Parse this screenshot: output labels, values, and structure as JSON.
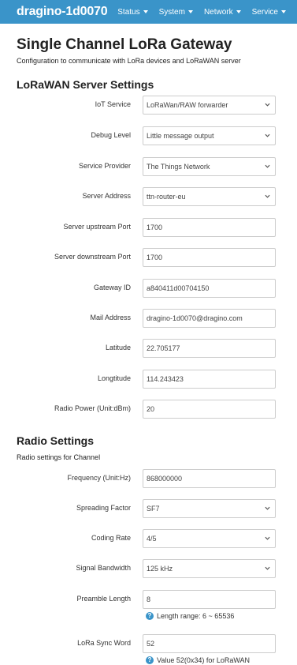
{
  "navbar": {
    "brand": "dragino-1d0070",
    "menu": [
      "Status",
      "System",
      "Network",
      "Service"
    ]
  },
  "page": {
    "title": "Single Channel LoRa Gateway",
    "description": "Configuration to communicate with LoRa devices and LoRaWAN server"
  },
  "lorawan": {
    "title": "LoRaWAN Server Settings",
    "fields": [
      {
        "label": "IoT Service",
        "value": "LoRaWan/RAW forwarder"
      },
      {
        "label": "Debug Level",
        "value": "Little message output"
      },
      {
        "label": "Service Provider",
        "value": "The Things Network"
      },
      {
        "label": "Server Address",
        "value": "ttn-router-eu"
      },
      {
        "label": "Server upstream Port",
        "value": "1700"
      },
      {
        "label": "Server downstream Port",
        "value": "1700"
      },
      {
        "label": "Gateway ID",
        "value": "a840411d00704150"
      },
      {
        "label": "Mail Address",
        "value": "dragino-1d0070@dragino.com"
      },
      {
        "label": "Latitude",
        "value": "22.705177"
      },
      {
        "label": "Longtitude",
        "value": "114.243423"
      },
      {
        "label": "Radio Power (Unit:dBm)",
        "value": "20"
      }
    ]
  },
  "radio": {
    "title": "Radio Settings",
    "description": "Radio settings for Channel",
    "fields": [
      {
        "label": "Frequency (Unit:Hz)",
        "value": "868000000"
      },
      {
        "label": "Spreading Factor",
        "value": "SF7"
      },
      {
        "label": "Coding Rate",
        "value": "4/5"
      },
      {
        "label": "Signal Bandwidth",
        "value": "125 kHz"
      },
      {
        "label": "Preamble Length",
        "value": "8",
        "help": "Length range: 6 ~ 65536"
      },
      {
        "label": "LoRa Sync Word",
        "value": "52",
        "help": "Value 52(0x34) for LoRaWAN"
      }
    ]
  },
  "colors": {
    "navbar": "#3a94c9",
    "help_icon": "#3a94c9"
  }
}
